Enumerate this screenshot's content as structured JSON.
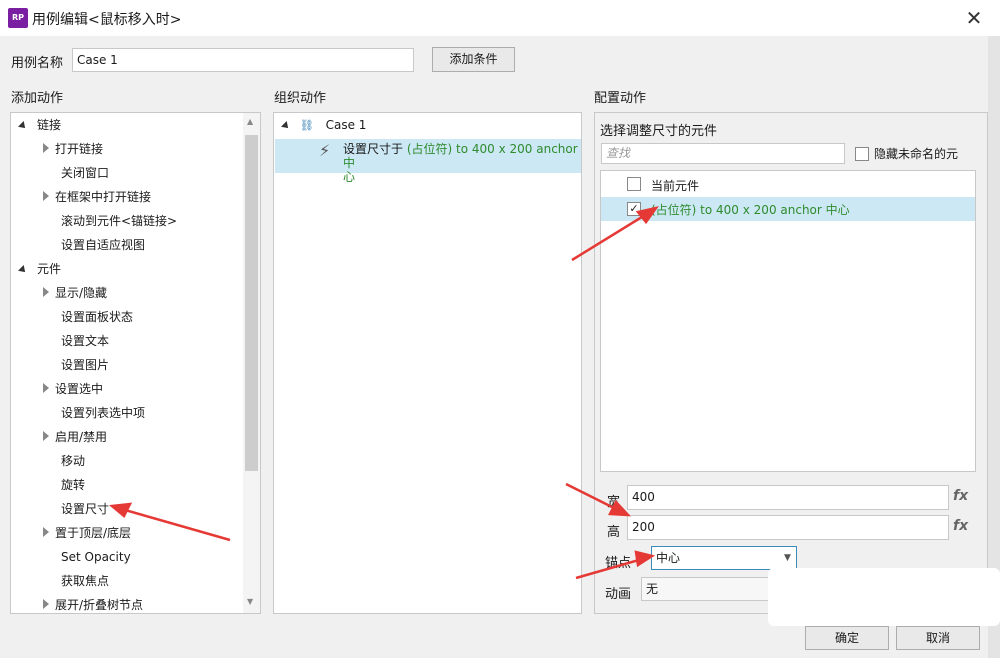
{
  "window": {
    "title": "用例编辑<鼠标移入时>",
    "app_icon": "RP"
  },
  "case_name": {
    "label": "用例名称",
    "value": "Case 1"
  },
  "add_condition_label": "添加条件",
  "headers": {
    "add_action": "添加动作",
    "organize_action": "组织动作",
    "configure_action": "配置动作"
  },
  "actions": [
    {
      "label": "链接",
      "level": 0,
      "state": "open"
    },
    {
      "label": "打开链接",
      "level": 1,
      "state": "closed"
    },
    {
      "label": "关闭窗口",
      "level": 1,
      "state": "none"
    },
    {
      "label": "在框架中打开链接",
      "level": 1,
      "state": "closed"
    },
    {
      "label": "滚动到元件<锚链接>",
      "level": 1,
      "state": "none"
    },
    {
      "label": "设置自适应视图",
      "level": 1,
      "state": "none"
    },
    {
      "label": "元件",
      "level": 0,
      "state": "open"
    },
    {
      "label": "显示/隐藏",
      "level": 1,
      "state": "closed"
    },
    {
      "label": "设置面板状态",
      "level": 1,
      "state": "none"
    },
    {
      "label": "设置文本",
      "level": 1,
      "state": "none"
    },
    {
      "label": "设置图片",
      "level": 1,
      "state": "none"
    },
    {
      "label": "设置选中",
      "level": 1,
      "state": "closed"
    },
    {
      "label": "设置列表选中项",
      "level": 1,
      "state": "none"
    },
    {
      "label": "启用/禁用",
      "level": 1,
      "state": "closed"
    },
    {
      "label": "移动",
      "level": 1,
      "state": "none"
    },
    {
      "label": "旋转",
      "level": 1,
      "state": "none"
    },
    {
      "label": "设置尺寸",
      "level": 1,
      "state": "none"
    },
    {
      "label": "置于顶层/底层",
      "level": 1,
      "state": "closed"
    },
    {
      "label": "Set Opacity",
      "level": 1,
      "state": "none"
    },
    {
      "label": "获取焦点",
      "level": 1,
      "state": "none"
    },
    {
      "label": "展开/折叠树节点",
      "level": 1,
      "state": "closed"
    }
  ],
  "organize": {
    "case_label": "Case 1",
    "action_prefix": "设置尺寸于",
    "action_target": "(占位符) to 400 x 200 anchor 中",
    "action_wrap": "心"
  },
  "configure": {
    "select_label": "选择调整尺寸的元件",
    "search_placeholder": "查找",
    "hide_unnamed_label": "隐藏未命名的元",
    "current_widget_label": "当前元件",
    "placeholder_item": "(占位符) to 400 x 200 anchor 中心",
    "width_label": "宽",
    "width_value": "400",
    "height_label": "高",
    "height_value": "200",
    "anchor_label": "锚点",
    "anchor_value": "中心",
    "animation_label": "动画",
    "animation_value": "无",
    "fx_label": "fx"
  },
  "footer": {
    "ok_label": "确定",
    "cancel_label": "取消"
  },
  "colors": {
    "accent_green": "#2e8b2e",
    "selection": "#cce8f4",
    "arrow_red": "#e53935"
  }
}
